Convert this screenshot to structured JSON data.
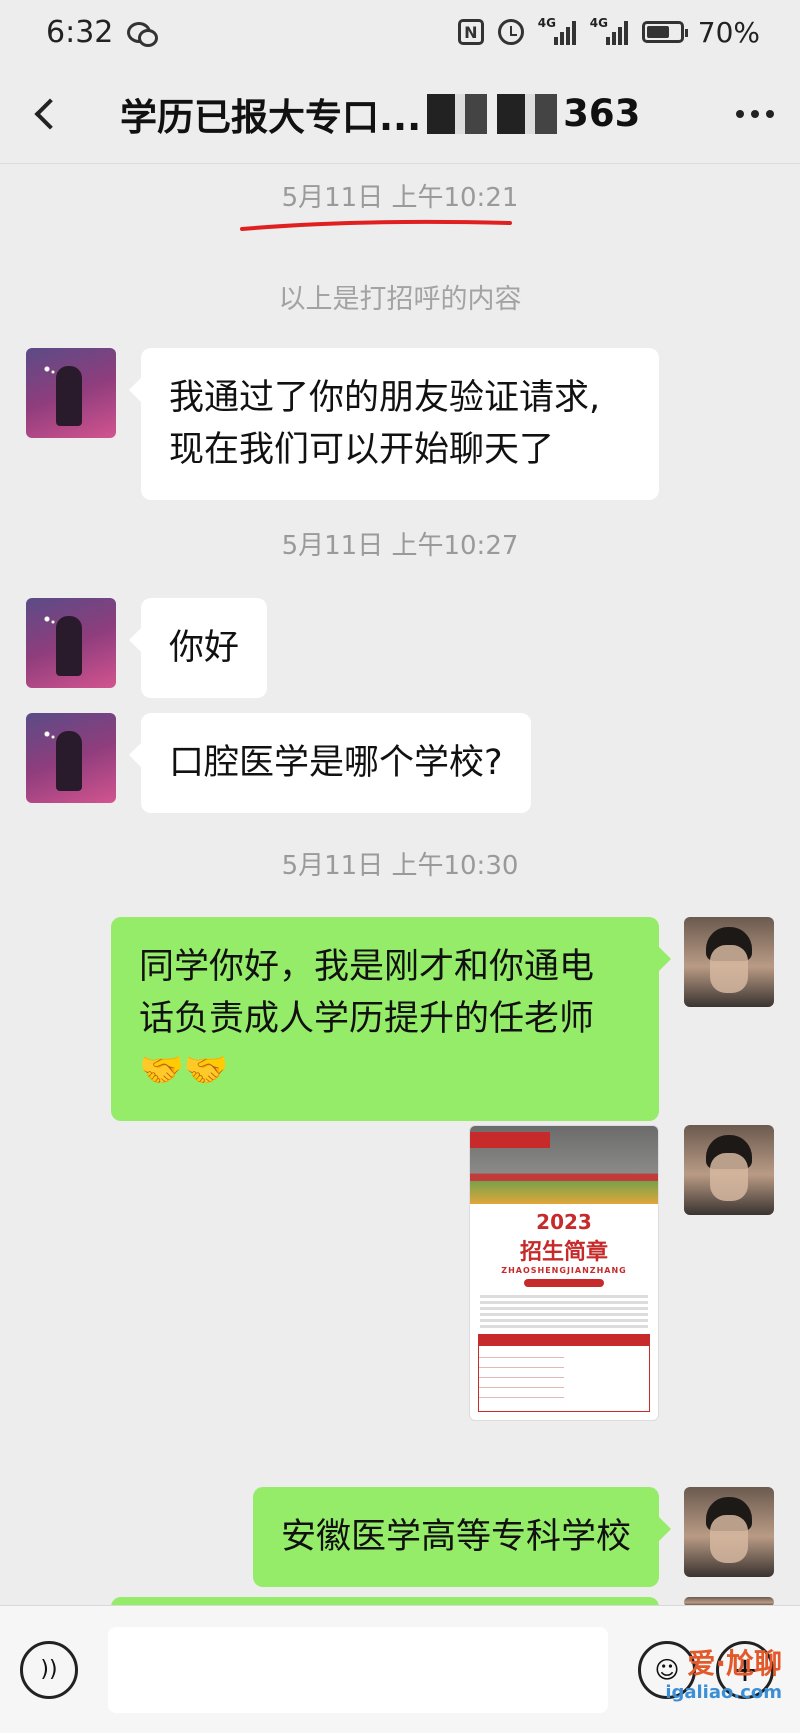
{
  "status_bar": {
    "time": "6:32",
    "signal1_label": "4G",
    "signal2_label": "4G",
    "battery": "70%",
    "battery_level": 0.7
  },
  "header": {
    "title_start": "学历已报大专口...",
    "title_end": "363"
  },
  "chat": {
    "messages": [
      {
        "type": "timestamp",
        "text": "5月11日 上午10:21"
      },
      {
        "type": "system",
        "text": "以上是打招呼的内容"
      },
      {
        "type": "incoming",
        "lines": [
          "我通过了你的朋友验证请求,",
          "现在我们可以开始聊天了"
        ]
      },
      {
        "type": "timestamp",
        "text": "5月11日 上午10:27"
      },
      {
        "type": "incoming",
        "lines": [
          "你好"
        ]
      },
      {
        "type": "incoming",
        "lines": [
          "口腔医学是哪个学校?"
        ]
      },
      {
        "type": "timestamp",
        "text": "5月11日 上午10:30"
      },
      {
        "type": "outgoing",
        "lines": [
          "同学你好，我是刚才和你通电",
          "话负责成人学历提升的任老师"
        ],
        "emoji": "🤝🤝"
      },
      {
        "type": "outgoing-image",
        "year": "2023",
        "heading": "招生简章",
        "subheading": "ZHAOSHENGJIANZHANG"
      },
      {
        "type": "outgoing",
        "lines": [
          "安徽医学高等专科学校"
        ]
      }
    ]
  },
  "input_bar": {
    "placeholder": ""
  },
  "watermark": {
    "line1": "爱·尬聊",
    "line2": "igaliao.com"
  },
  "colors": {
    "background": "#ededed",
    "outgoing_bubble": "#95ec69",
    "incoming_bubble": "#ffffff",
    "annotation_red": "#e02020"
  }
}
